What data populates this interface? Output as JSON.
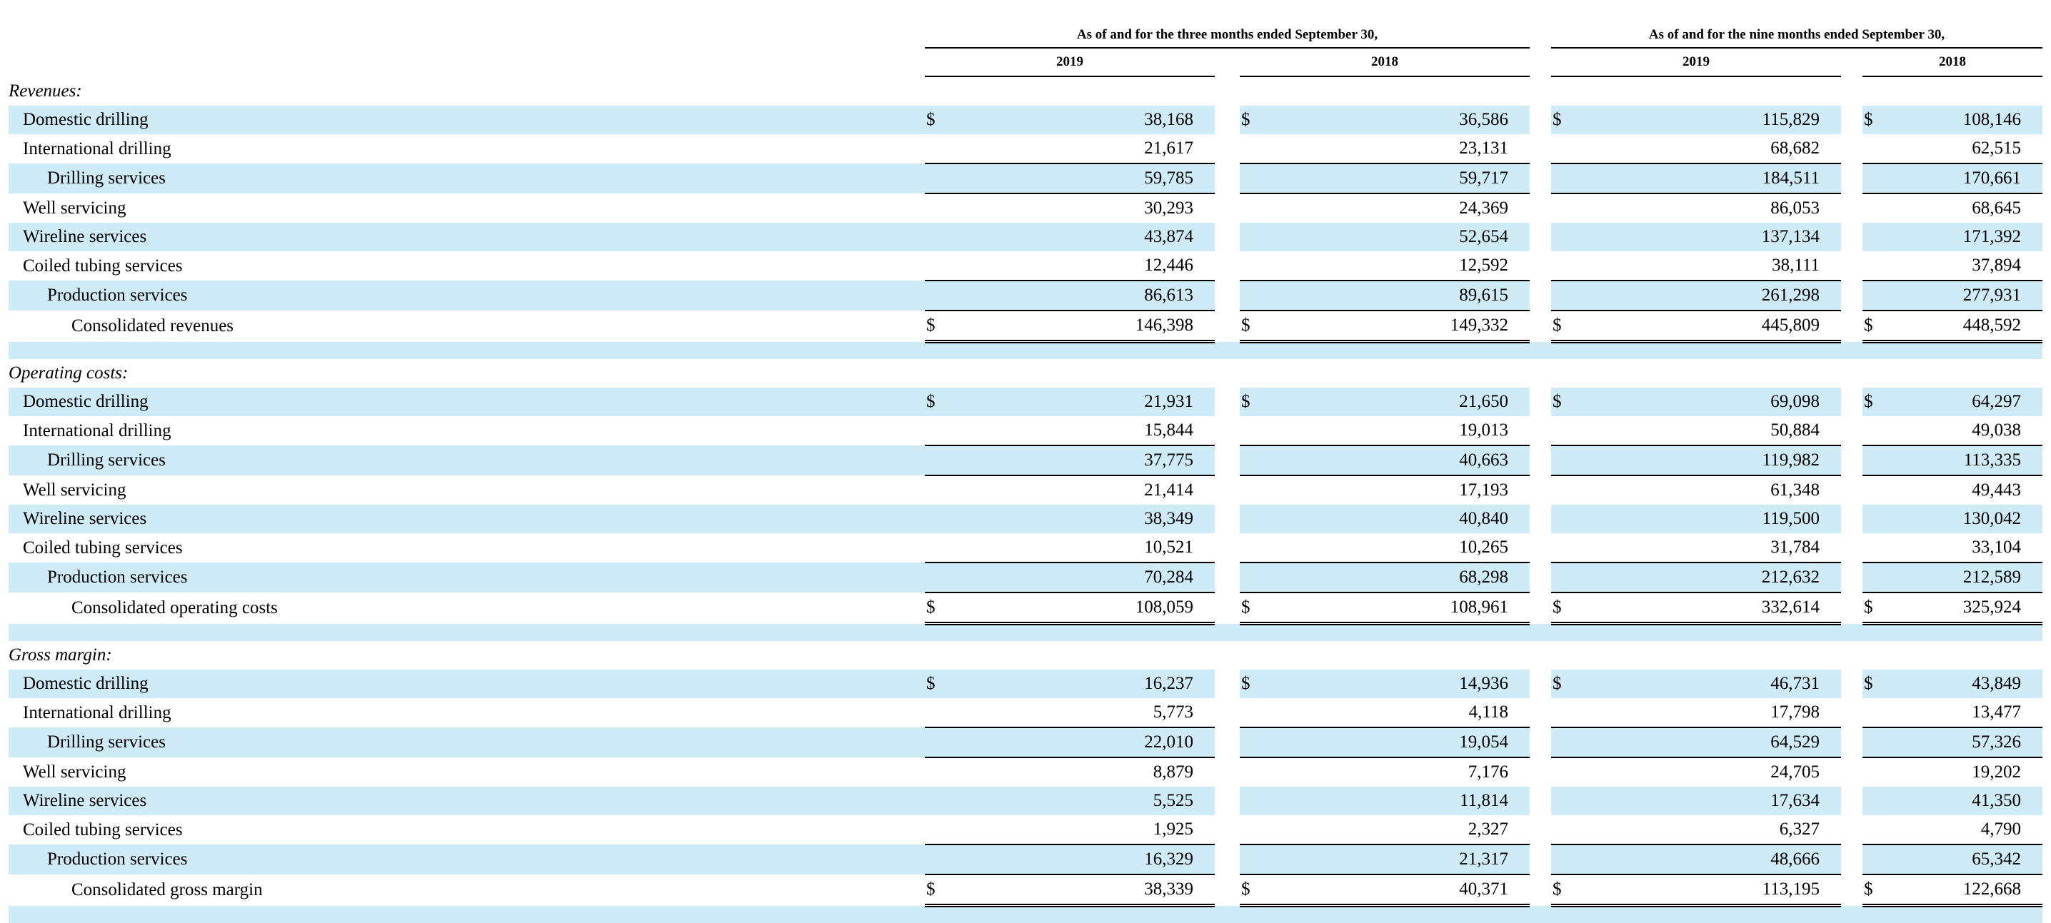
{
  "header": {
    "three_months": "As of and for the three months ended September 30,",
    "nine_months": "As of and for the nine months ended September 30,",
    "years": [
      "2019",
      "2018",
      "2019",
      "2018"
    ]
  },
  "currency": "$",
  "sections": [
    {
      "title": "Revenues:",
      "rows": [
        {
          "label": "Domestic drilling",
          "values": [
            "38,168",
            "36,586",
            "115,829",
            "108,146"
          ]
        },
        {
          "label": "International drilling",
          "values": [
            "21,617",
            "23,131",
            "68,682",
            "62,515"
          ]
        },
        {
          "label": "Drilling services",
          "values": [
            "59,785",
            "59,717",
            "184,511",
            "170,661"
          ]
        },
        {
          "label": "Well servicing",
          "values": [
            "30,293",
            "24,369",
            "86,053",
            "68,645"
          ]
        },
        {
          "label": "Wireline services",
          "values": [
            "43,874",
            "52,654",
            "137,134",
            "171,392"
          ]
        },
        {
          "label": "Coiled tubing services",
          "values": [
            "12,446",
            "12,592",
            "38,111",
            "37,894"
          ]
        },
        {
          "label": "Production services",
          "values": [
            "86,613",
            "89,615",
            "261,298",
            "277,931"
          ]
        },
        {
          "label": "Consolidated revenues",
          "values": [
            "146,398",
            "149,332",
            "445,809",
            "448,592"
          ]
        }
      ]
    },
    {
      "title": "Operating costs:",
      "rows": [
        {
          "label": "Domestic drilling",
          "values": [
            "21,931",
            "21,650",
            "69,098",
            "64,297"
          ]
        },
        {
          "label": "International drilling",
          "values": [
            "15,844",
            "19,013",
            "50,884",
            "49,038"
          ]
        },
        {
          "label": "Drilling services",
          "values": [
            "37,775",
            "40,663",
            "119,982",
            "113,335"
          ]
        },
        {
          "label": "Well servicing",
          "values": [
            "21,414",
            "17,193",
            "61,348",
            "49,443"
          ]
        },
        {
          "label": "Wireline services",
          "values": [
            "38,349",
            "40,840",
            "119,500",
            "130,042"
          ]
        },
        {
          "label": "Coiled tubing services",
          "values": [
            "10,521",
            "10,265",
            "31,784",
            "33,104"
          ]
        },
        {
          "label": "Production services",
          "values": [
            "70,284",
            "68,298",
            "212,632",
            "212,589"
          ]
        },
        {
          "label": "Consolidated operating costs",
          "values": [
            "108,059",
            "108,961",
            "332,614",
            "325,924"
          ]
        }
      ]
    },
    {
      "title": "Gross margin:",
      "rows": [
        {
          "label": "Domestic drilling",
          "values": [
            "16,237",
            "14,936",
            "46,731",
            "43,849"
          ]
        },
        {
          "label": "International drilling",
          "values": [
            "5,773",
            "4,118",
            "17,798",
            "13,477"
          ]
        },
        {
          "label": "Drilling services",
          "values": [
            "22,010",
            "19,054",
            "64,529",
            "57,326"
          ]
        },
        {
          "label": "Well servicing",
          "values": [
            "8,879",
            "7,176",
            "24,705",
            "19,202"
          ]
        },
        {
          "label": "Wireline services",
          "values": [
            "5,525",
            "11,814",
            "17,634",
            "41,350"
          ]
        },
        {
          "label": "Coiled tubing services",
          "values": [
            "1,925",
            "2,327",
            "6,327",
            "4,790"
          ]
        },
        {
          "label": "Production services",
          "values": [
            "16,329",
            "21,317",
            "48,666",
            "65,342"
          ]
        },
        {
          "label": "Consolidated gross margin",
          "values": [
            "38,339",
            "40,371",
            "113,195",
            "122,668"
          ]
        }
      ]
    }
  ],
  "colors": {
    "row_shade": "#cfebf8",
    "rule": "#000000"
  }
}
